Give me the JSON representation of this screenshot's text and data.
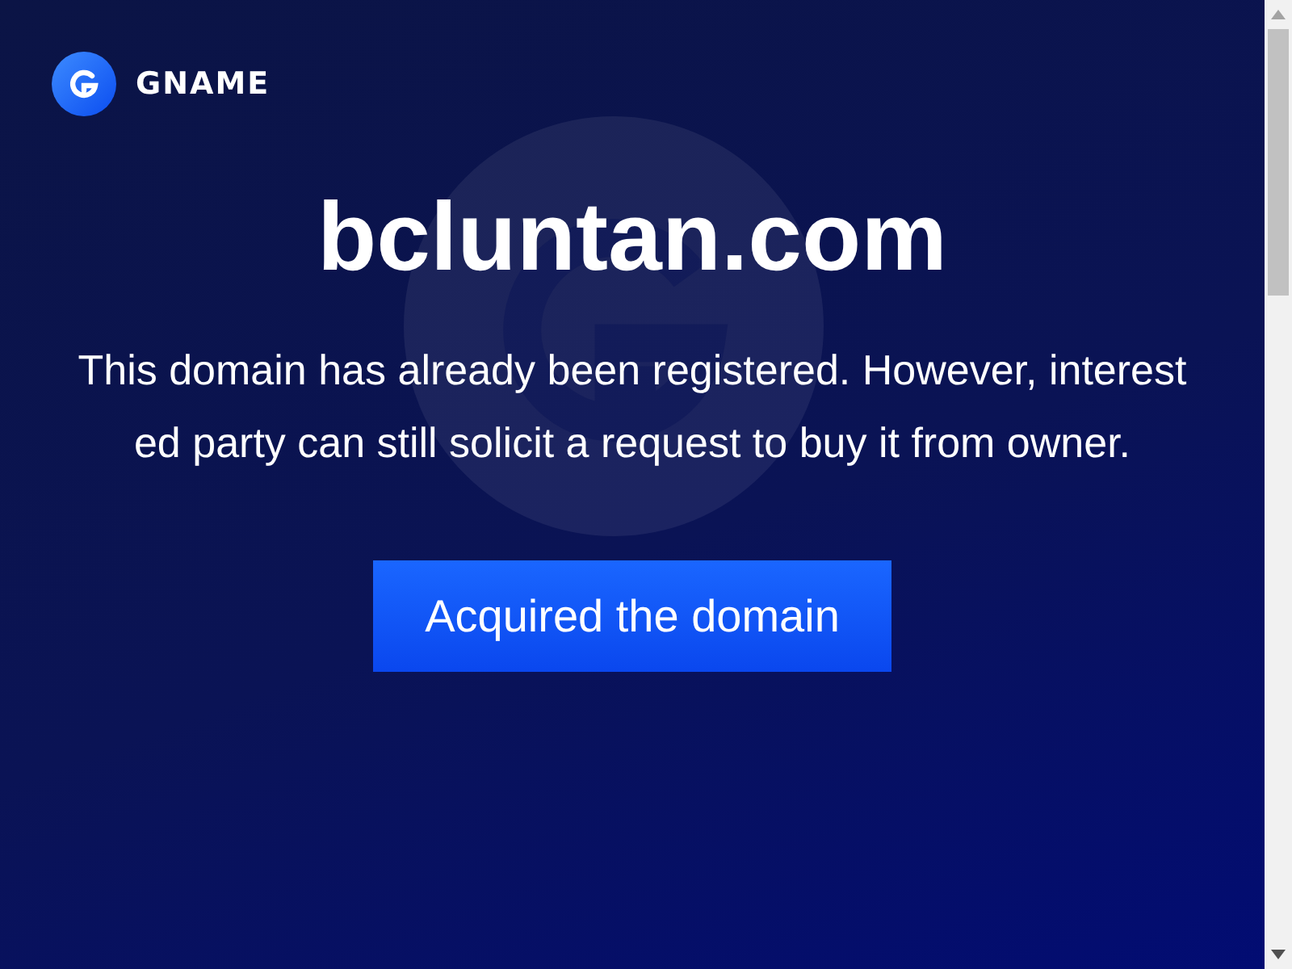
{
  "header": {
    "brand": "GNAME"
  },
  "hero": {
    "domain": "bcluntan.com",
    "message": "This domain has already been registered. However, interested party can still solicit a request to buy it from owner.",
    "button": "Acquired the domain"
  }
}
